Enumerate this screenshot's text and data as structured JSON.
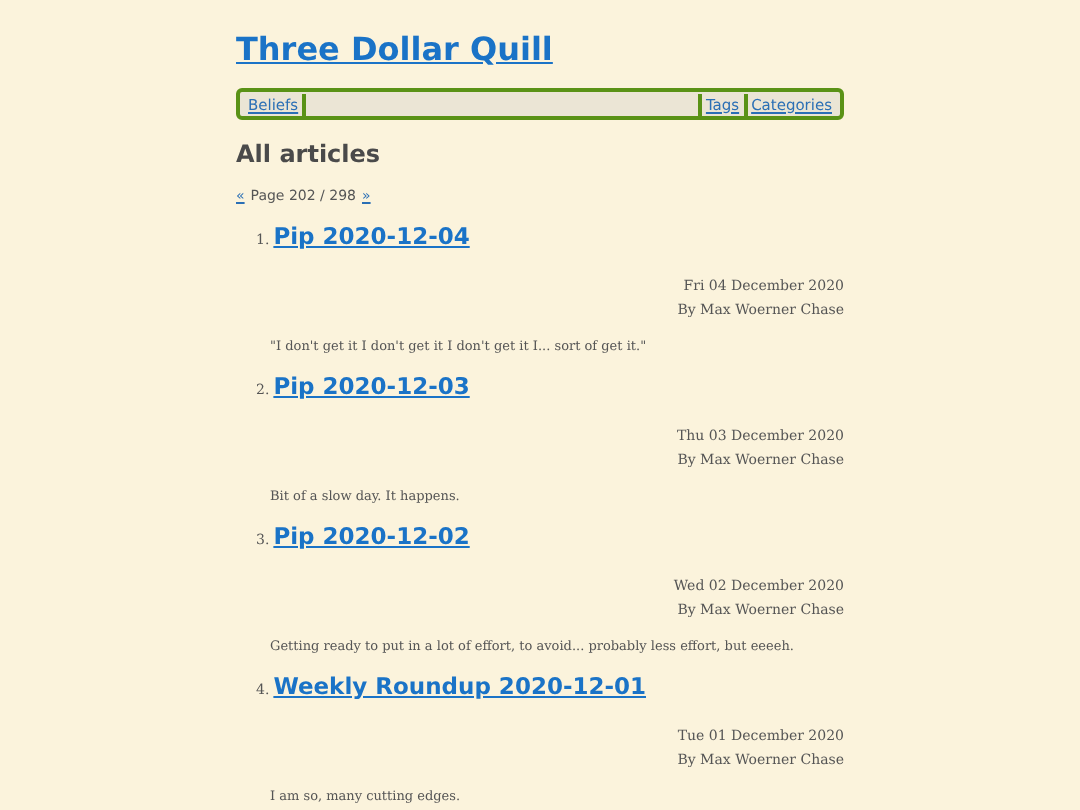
{
  "site_title": "Three Dollar Quill",
  "nav": {
    "left": [
      {
        "label": "Beliefs"
      }
    ],
    "right": [
      {
        "label": "Tags"
      },
      {
        "label": "Categories"
      }
    ]
  },
  "heading": "All articles",
  "pagination": {
    "prev": "«",
    "text": "Page 202 / 298",
    "next": "»"
  },
  "articles": [
    {
      "number": "1.",
      "title": "Pip 2020-12-04",
      "date": "Fri 04 December 2020",
      "author": "By Max Woerner Chase",
      "summary": "\"I don't get it I don't get it I don't get it I... sort of get it.\""
    },
    {
      "number": "2.",
      "title": "Pip 2020-12-03",
      "date": "Thu 03 December 2020",
      "author": "By Max Woerner Chase",
      "summary": "Bit of a slow day. It happens."
    },
    {
      "number": "3.",
      "title": "Pip 2020-12-02",
      "date": "Wed 02 December 2020",
      "author": "By Max Woerner Chase",
      "summary": "Getting ready to put in a lot of effort, to avoid... probably less effort, but eeeeh."
    },
    {
      "number": "4.",
      "title": "Weekly Roundup 2020-12-01",
      "date": "Tue 01 December 2020",
      "author": "By Max Woerner Chase",
      "summary": "I am so, many cutting edges."
    }
  ]
}
